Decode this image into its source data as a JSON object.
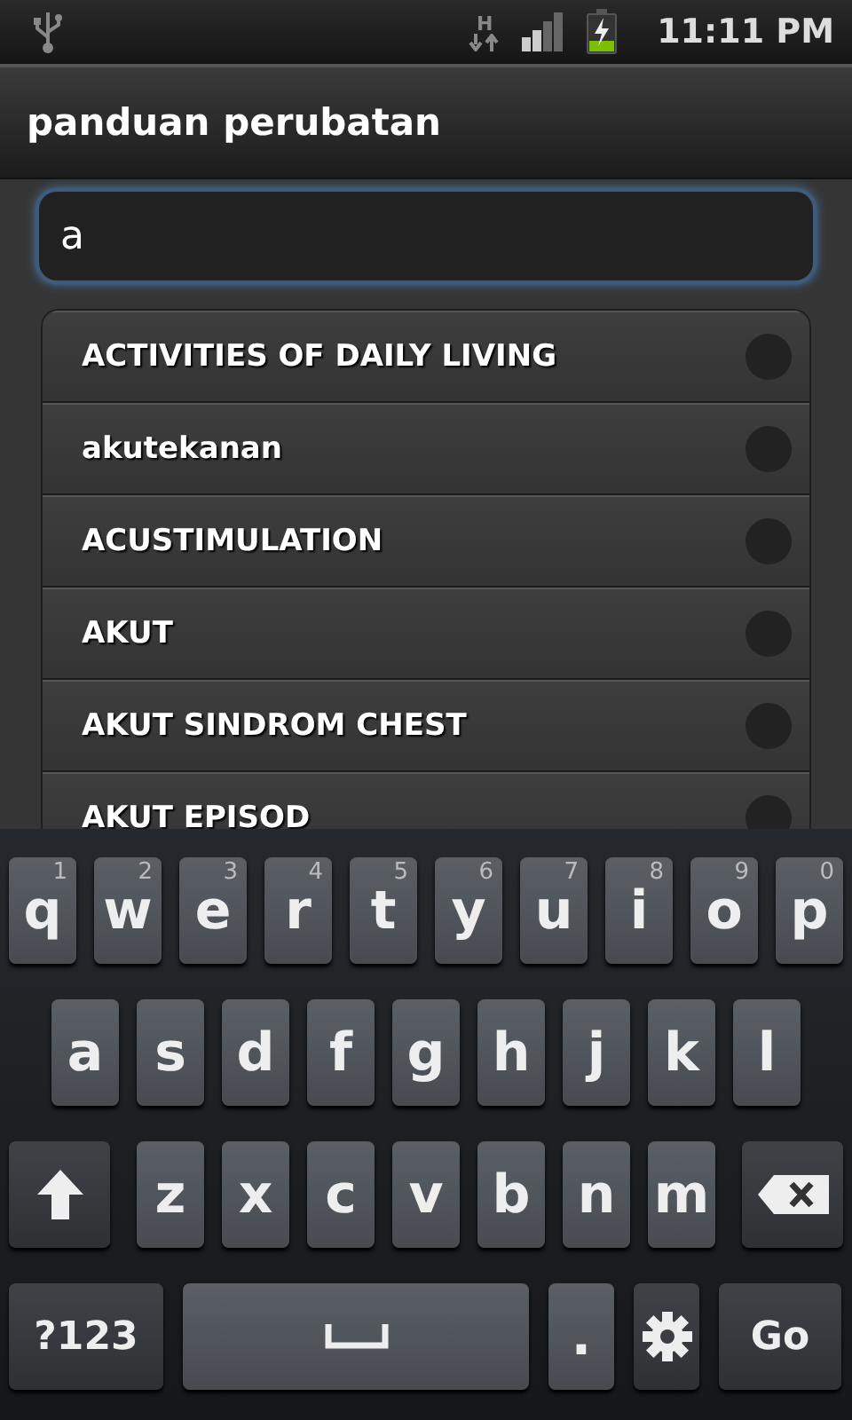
{
  "status_bar": {
    "network_type": "H",
    "time": "11:11 PM"
  },
  "title": "panduan perubatan",
  "search": {
    "value": "a"
  },
  "results": [
    {
      "label": "ACTIVITIES OF DAILY LIVING",
      "selected": false
    },
    {
      "label": "akutekanan",
      "selected": false
    },
    {
      "label": "ACUSTIMULATION",
      "selected": false
    },
    {
      "label": "AKUT",
      "selected": false
    },
    {
      "label": "AKUT SINDROM CHEST",
      "selected": false
    },
    {
      "label": "AKUT EPISOD",
      "selected": false
    }
  ],
  "keyboard": {
    "rows": [
      [
        {
          "kind": "letter",
          "label": "q",
          "hint": "1"
        },
        {
          "kind": "letter",
          "label": "w",
          "hint": "2"
        },
        {
          "kind": "letter",
          "label": "e",
          "hint": "3"
        },
        {
          "kind": "letter",
          "label": "r",
          "hint": "4"
        },
        {
          "kind": "letter",
          "label": "t",
          "hint": "5"
        },
        {
          "kind": "letter",
          "label": "y",
          "hint": "6"
        },
        {
          "kind": "letter",
          "label": "u",
          "hint": "7"
        },
        {
          "kind": "letter",
          "label": "i",
          "hint": "8"
        },
        {
          "kind": "letter",
          "label": "o",
          "hint": "9"
        },
        {
          "kind": "letter",
          "label": "p",
          "hint": "0"
        }
      ],
      [
        {
          "kind": "letter",
          "label": "a"
        },
        {
          "kind": "letter",
          "label": "s"
        },
        {
          "kind": "letter",
          "label": "d"
        },
        {
          "kind": "letter",
          "label": "f"
        },
        {
          "kind": "letter",
          "label": "g"
        },
        {
          "kind": "letter",
          "label": "h"
        },
        {
          "kind": "letter",
          "label": "j"
        },
        {
          "kind": "letter",
          "label": "k"
        },
        {
          "kind": "letter",
          "label": "l"
        }
      ],
      [
        {
          "kind": "shift"
        },
        {
          "kind": "letter",
          "label": "z"
        },
        {
          "kind": "letter",
          "label": "x"
        },
        {
          "kind": "letter",
          "label": "c"
        },
        {
          "kind": "letter",
          "label": "v"
        },
        {
          "kind": "letter",
          "label": "b"
        },
        {
          "kind": "letter",
          "label": "n"
        },
        {
          "kind": "letter",
          "label": "m"
        },
        {
          "kind": "backspace"
        }
      ],
      [
        {
          "kind": "symbols",
          "label": "?123"
        },
        {
          "kind": "space"
        },
        {
          "kind": "letter",
          "label": "."
        },
        {
          "kind": "settings"
        },
        {
          "kind": "go",
          "label": "Go"
        }
      ]
    ]
  }
}
